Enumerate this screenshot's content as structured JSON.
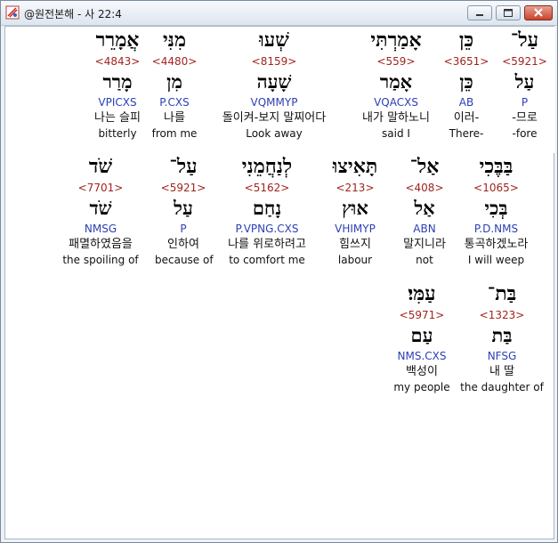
{
  "window": {
    "title": "@원전본해 - 사 22:4",
    "app_icon": "bible-app-icon",
    "controls": [
      "minimize-icon",
      "maximize-icon",
      "close-icon"
    ]
  },
  "rows": [
    {
      "words": [
        {
          "hebrew": "עַל־",
          "strong": "<5921>",
          "root": "עַל",
          "morph": "P",
          "korean": "-므로",
          "english": "-fore",
          "selected": true
        },
        {
          "hebrew": "כֵּן",
          "strong": "<3651>",
          "root": "כֵּן",
          "morph": "AB",
          "korean": "이러-",
          "english": "There-"
        },
        {
          "hebrew": "אָמַרְתִּי",
          "strong": "<559>",
          "root": "אָמַר",
          "morph": "VQACXS",
          "korean": "내가 말하노니",
          "english": "said I"
        },
        {
          "hebrew": "שְׁעוּ",
          "strong": "<8159>",
          "root": "שָׁעָה",
          "morph": "VQMMYP",
          "korean": "돌이켜-보지 말찌어다",
          "english": "Look away"
        },
        {
          "hebrew": "מִנִּי",
          "strong": "<4480>",
          "root": "מִן",
          "morph": "P.CXS",
          "korean": "나를",
          "english": "from me"
        },
        {
          "hebrew": "אֲמָרֵר",
          "strong": "<4843>",
          "root": "מָרַר",
          "morph": "VPICXS",
          "korean": "나는 슬피",
          "english": "bitterly"
        }
      ]
    },
    {
      "words": [
        {
          "hebrew": "בַּבֶּכִי",
          "strong": "<1065>",
          "root": "בְּכִי",
          "morph": "P.D.NMS",
          "korean": "통곡하겠노라",
          "english": "I will weep"
        },
        {
          "hebrew": "אַל־",
          "strong": "<408>",
          "root": "אַל",
          "morph": "ABN",
          "korean": "말지니라",
          "english": "not"
        },
        {
          "hebrew": "תָּאִיצוּ",
          "strong": "<213>",
          "root": "אוּץ",
          "morph": "VHIMYP",
          "korean": "힘쓰지",
          "english": "labour"
        },
        {
          "hebrew": "לְנַחֲמֵנִי",
          "strong": "<5162>",
          "root": "נָחַם",
          "morph": "P.VPNG.CXS",
          "korean": "나를 위로하려고",
          "english": "to comfort me"
        },
        {
          "hebrew": "עַל־",
          "strong": "<5921>",
          "root": "עַל",
          "morph": "P",
          "korean": "인하여",
          "english": "because of"
        },
        {
          "hebrew": "שֹׁד",
          "strong": "<7701>",
          "root": "שֹׁד",
          "morph": "NMSG",
          "korean": "패멸하였음을",
          "english": "the spoiling of"
        }
      ]
    },
    {
      "words": [
        {
          "hebrew": "בַּת־",
          "strong": "<1323>",
          "root": "בַּת",
          "morph": "NFSG",
          "korean": "내 딸",
          "english": "the daughter of"
        },
        {
          "hebrew": "עַמִּי׃",
          "strong": "<5971>",
          "root": "עַם",
          "morph": "NMS.CXS",
          "korean": "백성이",
          "english": "my people"
        }
      ]
    }
  ]
}
